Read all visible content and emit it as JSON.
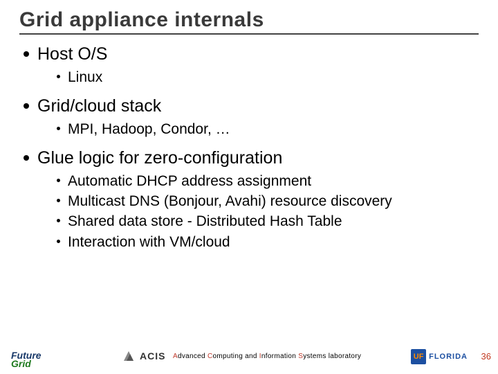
{
  "title": "Grid appliance internals",
  "bullets": [
    {
      "text": "Host O/S",
      "sub": [
        "Linux"
      ]
    },
    {
      "text": "Grid/cloud stack",
      "sub": [
        "MPI, Hadoop, Condor, …"
      ]
    },
    {
      "text": "Glue logic for zero-configuration",
      "sub": [
        "Automatic DHCP address assignment",
        "Multicast DNS (Bonjour, Avahi) resource discovery",
        "Shared data store - Distributed Hash Table",
        "Interaction with VM/cloud"
      ]
    }
  ],
  "footer": {
    "futuregrid": {
      "line1": "Future",
      "line2": "Grid"
    },
    "acis_label": "ACIS",
    "lab_parts": {
      "a": "A",
      "rest1": "dvanced ",
      "c": "C",
      "rest2": "omputing and ",
      "i": "I",
      "rest3": "nformation ",
      "s": "S",
      "rest4": "ystems laboratory"
    },
    "uf": {
      "badge": "UF",
      "word": "FLORIDA"
    },
    "page": "36"
  }
}
